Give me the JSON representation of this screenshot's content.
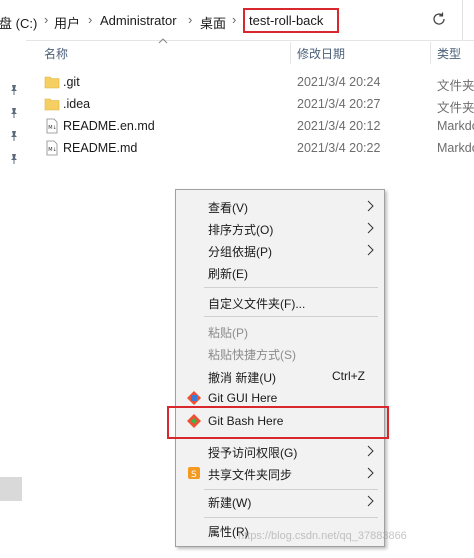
{
  "address_bar": {
    "crumbs": [
      "磁盘 (C:)",
      "用户",
      "Administrator",
      "桌面"
    ],
    "current": "test-roll-back"
  },
  "columns": {
    "name": "名称",
    "date": "修改日期",
    "type": "类型"
  },
  "files": [
    {
      "name": ".git",
      "date": "2021/3/4 20:24",
      "type": "文件夹",
      "icon": "folder-icon"
    },
    {
      "name": ".idea",
      "date": "2021/3/4 20:27",
      "type": "文件夹",
      "icon": "folder-icon"
    },
    {
      "name": "README.en.md",
      "date": "2021/3/4 20:12",
      "type": "Markdown",
      "icon": "md-file-icon"
    },
    {
      "name": "README.md",
      "date": "2021/3/4 20:22",
      "type": "Markdown",
      "icon": "md-file-icon"
    }
  ],
  "context_menu": {
    "view": "查看(V)",
    "sort_by": "排序方式(O)",
    "group_by": "分组依据(P)",
    "refresh": "刷新(E)",
    "customize_folder": "自定义文件夹(F)...",
    "paste": "粘贴(P)",
    "paste_shortcut": "粘贴快捷方式(S)",
    "undo_new": "撤消 新建(U)",
    "undo_shortcut": "Ctrl+Z",
    "git_gui": "Git GUI Here",
    "git_bash": "Git Bash Here",
    "grant_access": "授予访问权限(G)",
    "share_sync": "共享文件夹同步",
    "new": "新建(W)",
    "properties": "属性(R)"
  },
  "watermark": "https://blog.csdn.net/qq_37883866",
  "colors": {
    "highlight_red": "#d9272e",
    "folder": "#f5cf62",
    "git_orange": "#f05133"
  }
}
